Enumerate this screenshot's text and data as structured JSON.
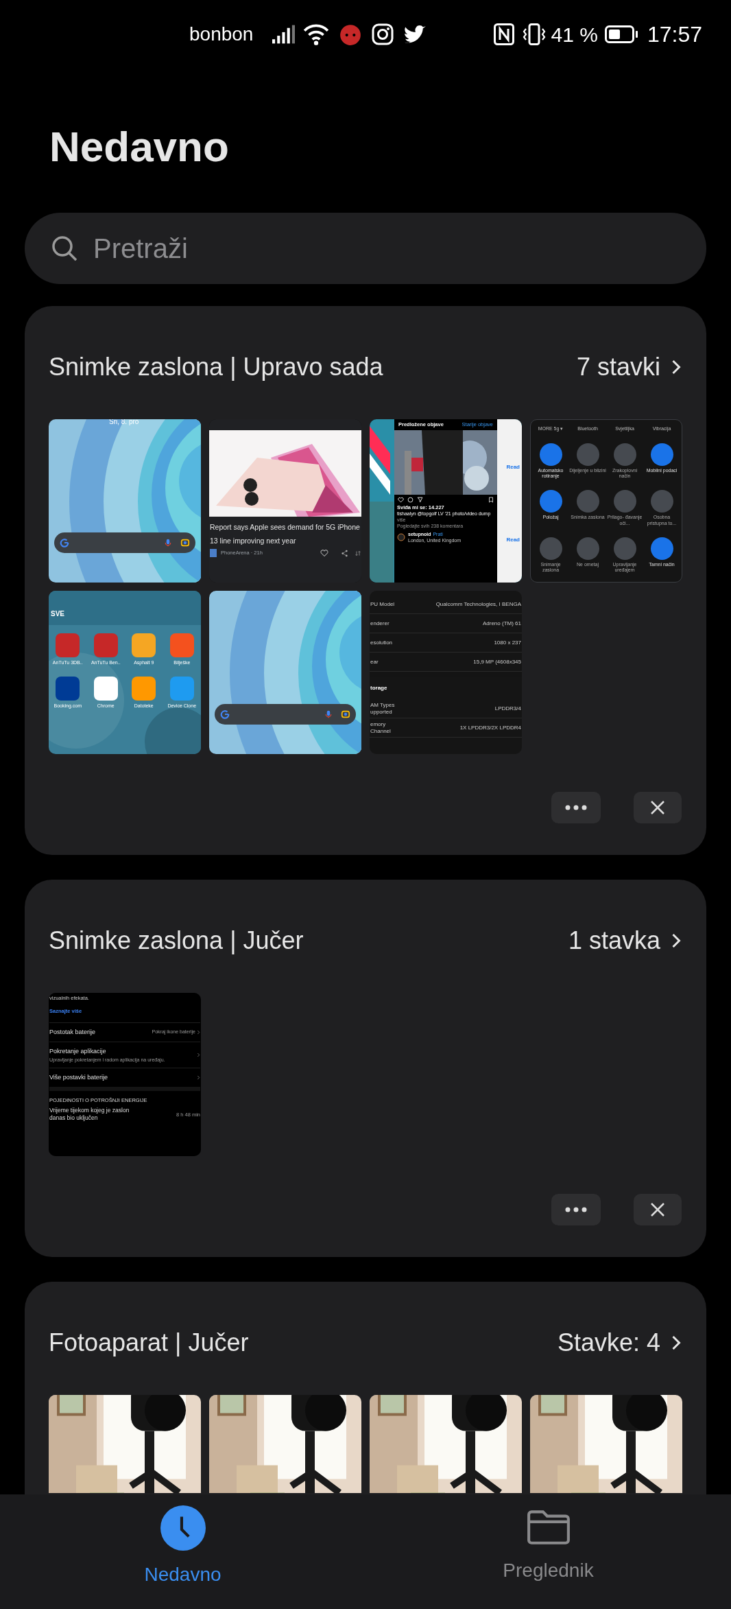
{
  "status_bar": {
    "carrier": "bonbon",
    "battery_percent": "41 %",
    "time": "17:57"
  },
  "title": "Nedavno",
  "search": {
    "placeholder": "Pretraži"
  },
  "albums": [
    {
      "title": "Snimke zaslona | Upravo sada",
      "count": "7 stavki",
      "show_actions": true,
      "thumbnails": [
        {
          "kind": "home_screen",
          "date": "Sri, 8. pro"
        },
        {
          "kind": "news",
          "headline": "Report says Apple sees demand for 5G iPhone 13 line improving next year",
          "source": "PhoneArena · 21h"
        },
        {
          "kind": "instagram",
          "header": "Predložene objave",
          "link": "Starije objave",
          "likes": "Sviđa mi se: 14.227",
          "caption": "tishaalyn @topgolf LV '21 photo/video dump",
          "more": "više",
          "comments": "Pogledajte svih 238 komentara",
          "user": "setupnoid",
          "follow": "Prati",
          "location": "London, United Kingdom",
          "side_links": [
            "Read",
            "Read"
          ]
        },
        {
          "kind": "quick_settings",
          "top_labels": [
            "MORE 5g ▾",
            "Bluetooth",
            "Svjetiljka",
            "Vibracija"
          ],
          "tiles": [
            {
              "label": "Automatsko rotiranje",
              "on": true
            },
            {
              "label": "Dijeljenje u blizini",
              "on": false
            },
            {
              "label": "Zrakoplovni način",
              "on": false
            },
            {
              "label": "Mobilni podaci",
              "on": true
            },
            {
              "label": "Položaj",
              "on": true
            },
            {
              "label": "Snimka zaslona",
              "on": false
            },
            {
              "label": "Prilago- đavanje oči...",
              "on": false
            },
            {
              "label": "Osobna pristupna to...",
              "on": false
            },
            {
              "label": "Snimanje zaslona",
              "on": false
            },
            {
              "label": "Ne ometaj",
              "on": false
            },
            {
              "label": "Upravljanje uređajem",
              "on": false
            },
            {
              "label": "Tamni način",
              "on": true
            }
          ]
        },
        {
          "kind": "app_drawer",
          "section": "SVE",
          "apps": [
            {
              "label": "AnTuTu 3DB..",
              "color": "#c62828"
            },
            {
              "label": "AnTuTu Ben..",
              "color": "#c62828"
            },
            {
              "label": "Asphalt 9",
              "color": "#f5a623"
            },
            {
              "label": "Bilješke",
              "color": "#f4511e"
            },
            {
              "label": "Booking.com",
              "color": "#003b95"
            },
            {
              "label": "Chrome",
              "color": "#ffffff"
            },
            {
              "label": "Datoteke",
              "color": "#ff9800"
            },
            {
              "label": "Device Clone",
              "color": "#1e9bf0"
            }
          ]
        },
        {
          "kind": "home_screen"
        },
        {
          "kind": "device_info",
          "rows": [
            {
              "label": "PU Model",
              "value": "Qualcomm Technologies, I BENGA"
            },
            {
              "label": "enderer",
              "value": "Adreno (TM) 61"
            },
            {
              "label": "esolution",
              "value": "1080 x 237"
            },
            {
              "label": "ear",
              "value": "15,9 MP (4608x345"
            }
          ],
          "section": "torage",
          "rows2": [
            {
              "label": "AM Types upported",
              "value": "LPDDR3/4"
            },
            {
              "label": "emory Channel",
              "value": "1X LPDDR3/2X LPDDR4"
            }
          ]
        }
      ]
    },
    {
      "title": "Snimke zaslona | Jučer",
      "count": "1 stavka",
      "show_actions": true,
      "thumbnails": [
        {
          "kind": "battery_settings",
          "intro": "vizualnih efekata.",
          "link": "Saznajte više",
          "rows": [
            {
              "title": "Postotak baterije",
              "value": "Pokraj ikone baterije"
            },
            {
              "title": "Pokretanje aplikacije",
              "subtitle": "Upravljanje pokretanjem i radom aplikacija na uređaju."
            },
            {
              "title": "Više postavki baterije"
            }
          ],
          "section": "POJEDINOSTI O POTROŠNJI ENERGIJE",
          "stat_label": "Vrijeme tijekom kojeg je zaslon danas bio uključen",
          "stat_value": "8 h 48 min"
        }
      ]
    },
    {
      "title": "Fotoaparat | Jučer",
      "count": "Stavke: 4"
    }
  ],
  "bottom_nav": [
    {
      "label": "Nedavno",
      "selected": true
    },
    {
      "label": "Preglednik",
      "selected": false
    }
  ]
}
